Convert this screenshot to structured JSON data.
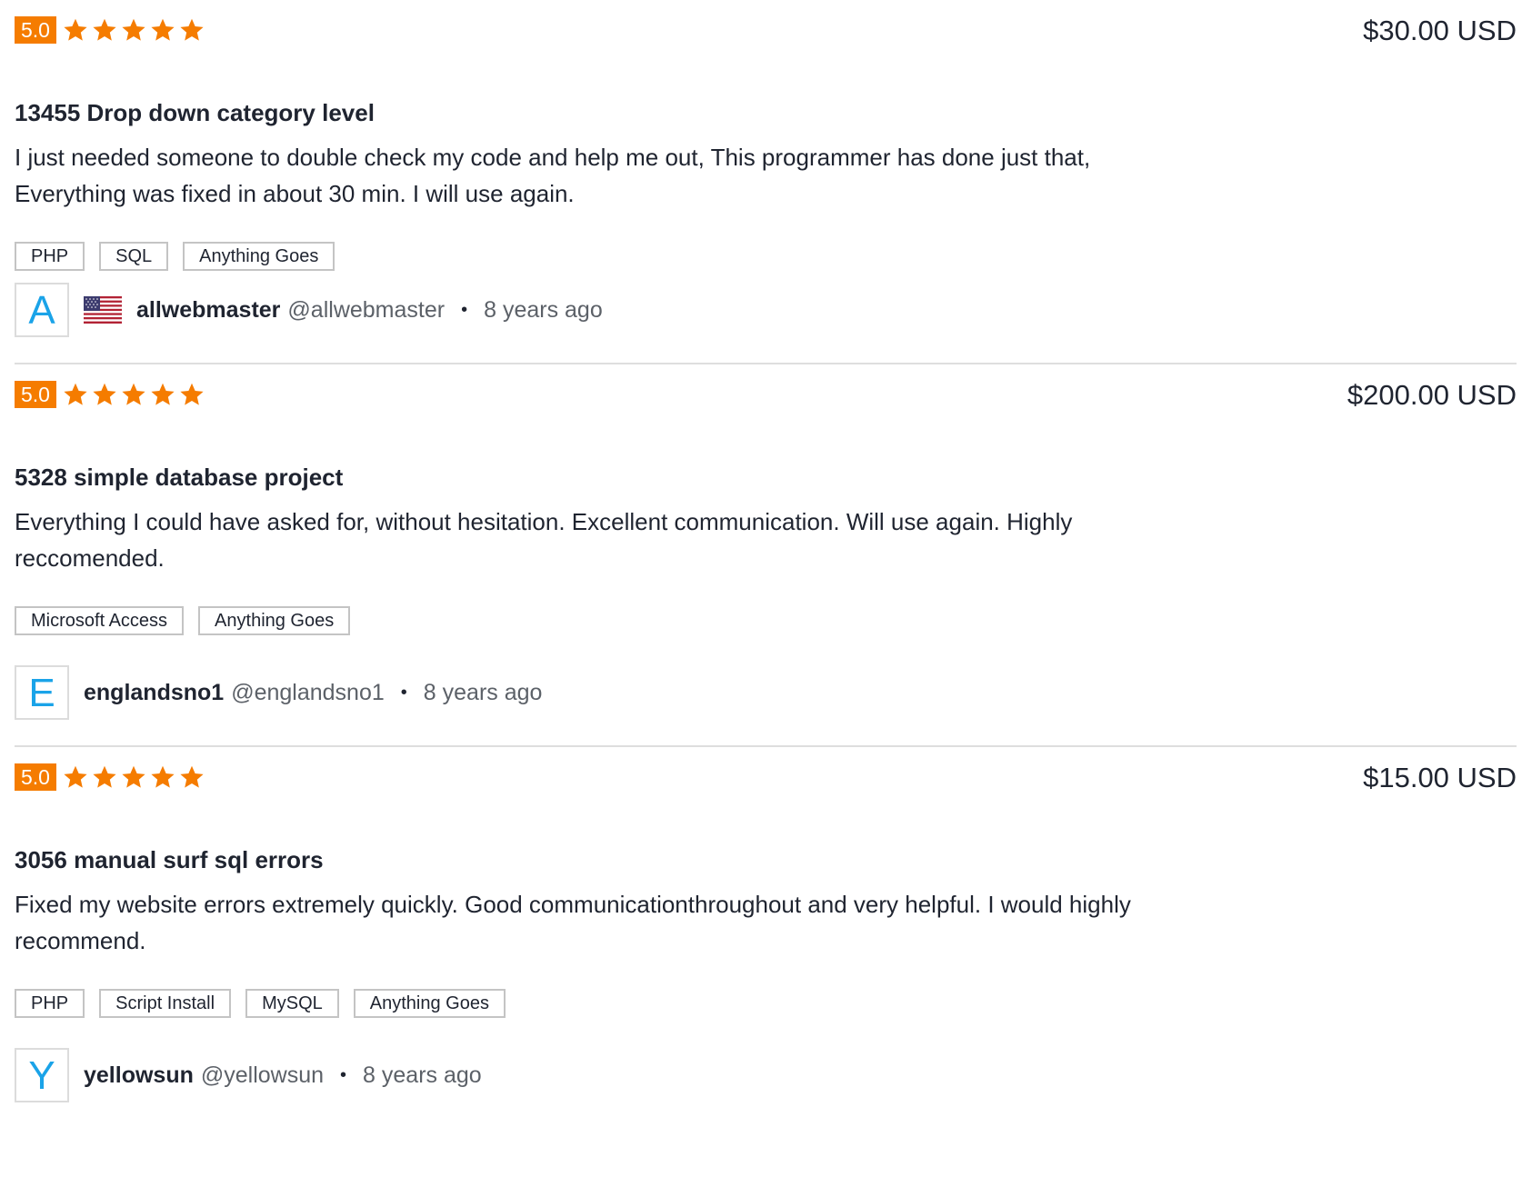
{
  "colors": {
    "accent": "#f57c00",
    "avatar_letter": "#1aa3e8",
    "divider": "#dedede"
  },
  "reviews": [
    {
      "score": "5.0",
      "stars": 5,
      "price": "$30.00 USD",
      "title": "13455 Drop down category level",
      "comment": "I just needed someone to double check my code and help me out, This programmer has done just that, Everything was fixed in about 30 min. I will use again.",
      "tags": [
        "PHP",
        "SQL",
        "Anything Goes"
      ],
      "user": {
        "initial": "A",
        "flag": "us-flag-icon",
        "username": "allwebmaster",
        "handle": "@allwebmaster",
        "separator": "•",
        "ago": "8 years ago"
      }
    },
    {
      "score": "5.0",
      "stars": 5,
      "price": "$200.00 USD",
      "title": "5328 simple database project",
      "comment": "Everything I could have asked for, without hesitation. Excellent communication. Will use again. Highly reccomended.",
      "tags": [
        "Microsoft Access",
        "Anything Goes"
      ],
      "user": {
        "initial": "E",
        "username": "englandsno1",
        "handle": "@englandsno1",
        "separator": "•",
        "ago": "8 years ago"
      }
    },
    {
      "score": "5.0",
      "stars": 5,
      "price": "$15.00 USD",
      "title": "3056 manual surf sql errors",
      "comment": "Fixed my website errors extremely quickly. Good communicationthroughout and very helpful. I would highly recommend.",
      "tags": [
        "PHP",
        "Script Install",
        "MySQL",
        "Anything Goes"
      ],
      "user": {
        "initial": "Y",
        "username": "yellowsun",
        "handle": "@yellowsun",
        "separator": "•",
        "ago": "8 years ago"
      }
    }
  ]
}
